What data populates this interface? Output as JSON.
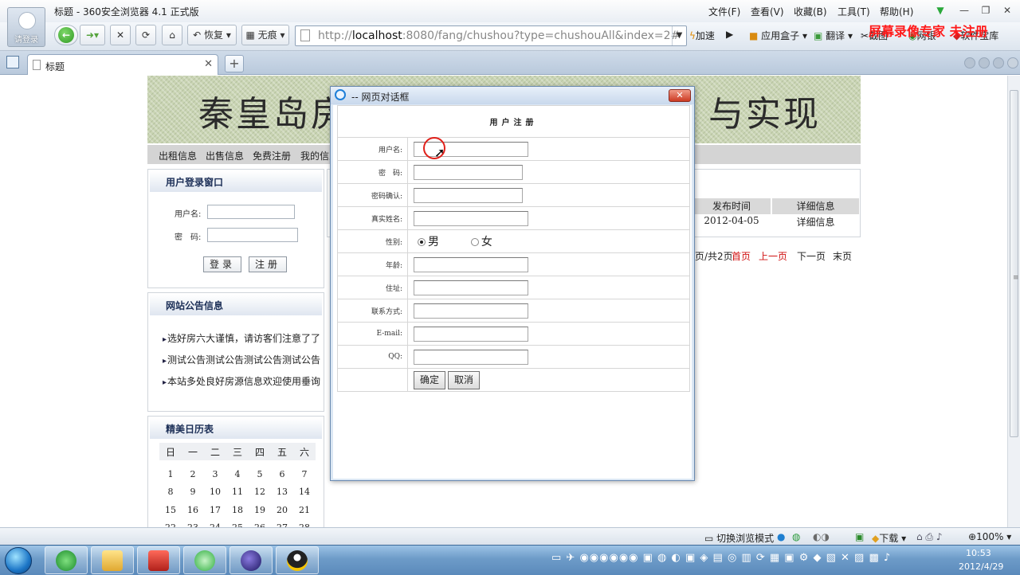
{
  "window": {
    "title": "标题 - 360安全浏览器 4.1 正式版",
    "avatar_label": "请登录",
    "menu": [
      "文件(F)",
      "查看(V)",
      "收藏(B)",
      "工具(T)",
      "帮助(H)"
    ]
  },
  "toolbar": {
    "restore_label": "恢复",
    "incognito_label": "无痕",
    "url_prefix": "http://",
    "url_host": "localhost",
    "url_rest": ":8080/fang/chushou?type=chushouAll&index=2#",
    "accelerate_label": "加速",
    "app_box_label": "应用盒子",
    "translate_label": "翻译",
    "screenshot_label": "截图",
    "netbank_label": "网银",
    "software_label": "软件宝库",
    "watermark": "屏幕录像专家 未注册"
  },
  "tab": {
    "title": "标题"
  },
  "page": {
    "banner_left": "秦皇岛房",
    "banner_right": "与实现",
    "nav": [
      "出租信息",
      "出售信息",
      "免费注册",
      "我的信息"
    ],
    "login": {
      "title": "用户登录窗口",
      "username_label": "用户名:",
      "password_label": "密　码:",
      "login_btn": "登录",
      "register_btn": "注册"
    },
    "notices": {
      "title": "网站公告信息",
      "items": [
        "选好房六大谨慎，请访客们注意了了",
        "测试公告测试公告测试公告测试公告",
        "本站多处良好房源信息欢迎使用垂询"
      ]
    },
    "calendar": {
      "title": "精美日历表",
      "weekdays": [
        "日",
        "一",
        "二",
        "三",
        "四",
        "五",
        "六"
      ],
      "rows": [
        [
          "1",
          "2",
          "3",
          "4",
          "5",
          "6",
          "7"
        ],
        [
          "8",
          "9",
          "10",
          "11",
          "12",
          "13",
          "14"
        ],
        [
          "15",
          "16",
          "17",
          "18",
          "19",
          "20",
          "21"
        ],
        [
          "22",
          "23",
          "24",
          "25",
          "26",
          "27",
          "28"
        ]
      ]
    },
    "listing": {
      "col_date": "发布时间",
      "col_detail": "详细信息",
      "row_date": "2012-04-05",
      "row_detail": "详细信息"
    },
    "pager": {
      "info": "页/共2页",
      "first": "首页",
      "prev": "上一页",
      "next": "下一页",
      "last": "末页"
    }
  },
  "dialog": {
    "title": "-- 网页对话框",
    "heading": "用户注册",
    "fields": {
      "username": "用户名:",
      "password": "密　码:",
      "confirm": "密码确认:",
      "realname": "真实姓名:",
      "sex": "性别:",
      "age": "年龄:",
      "address": "住址:",
      "contact": "联系方式:",
      "email": "E-mail:",
      "qq": "QQ:"
    },
    "sex_male": "男",
    "sex_female": "女",
    "ok_label": "确定",
    "cancel_label": "取消"
  },
  "statusbar": {
    "switch_mode": "切换浏览模式",
    "download": "下载",
    "zoom": "100%"
  },
  "taskbar": {
    "time": "10:53",
    "date": "2012/4/29"
  }
}
